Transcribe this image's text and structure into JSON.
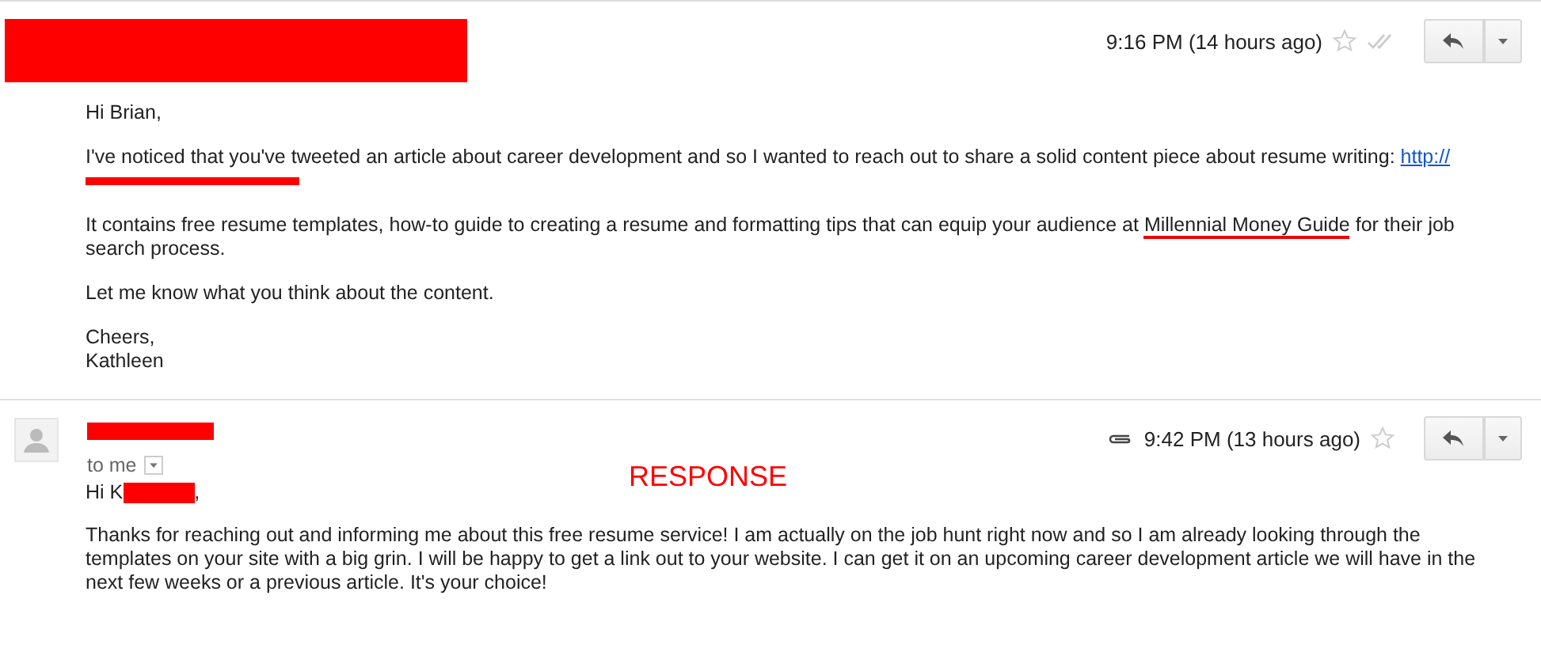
{
  "messages": [
    {
      "kind": "full",
      "time": "9:16 PM (14 hours ago)",
      "starred": false,
      "body": [
        {
          "kind": "text",
          "text": "Hi Brian,"
        },
        {
          "kind": "link_redacted",
          "text": "I've noticed that you've tweeted an article about career development and so I wanted to reach out to share a solid content piece about resume writing:",
          "link": "http://"
        },
        {
          "kind": "highlight",
          "before": "It contains free resume templates, how-to guide to creating a resume and formatting tips that can equip your audience at",
          "highlight": "Millennial Money Guide",
          "after": "for their job search process."
        },
        {
          "kind": "text",
          "text": "Let me know what you think about the content."
        },
        {
          "kind": "lines",
          "lines": [
            "Cheers,",
            "Kathleen"
          ]
        }
      ]
    },
    {
      "kind": "reply",
      "recipient": "to me",
      "annotation": "RESPONSE",
      "time": "9:42 PM (13 hours ago)",
      "starred": false,
      "body": [
        {
          "kind": "name_redacted",
          "text": "Hi K",
          "after": ","
        },
        {
          "kind": "text",
          "text": "Thanks for reaching out and informing me about this free resume service! I am actually on the job hunt right now and so I am already looking through the templates on your site with a big grin. I will be happy to get a link out to your website. I can get it on an upcoming career development article we will have in the next few weeks or a previous article. It's your choice!"
        }
      ]
    }
  ]
}
